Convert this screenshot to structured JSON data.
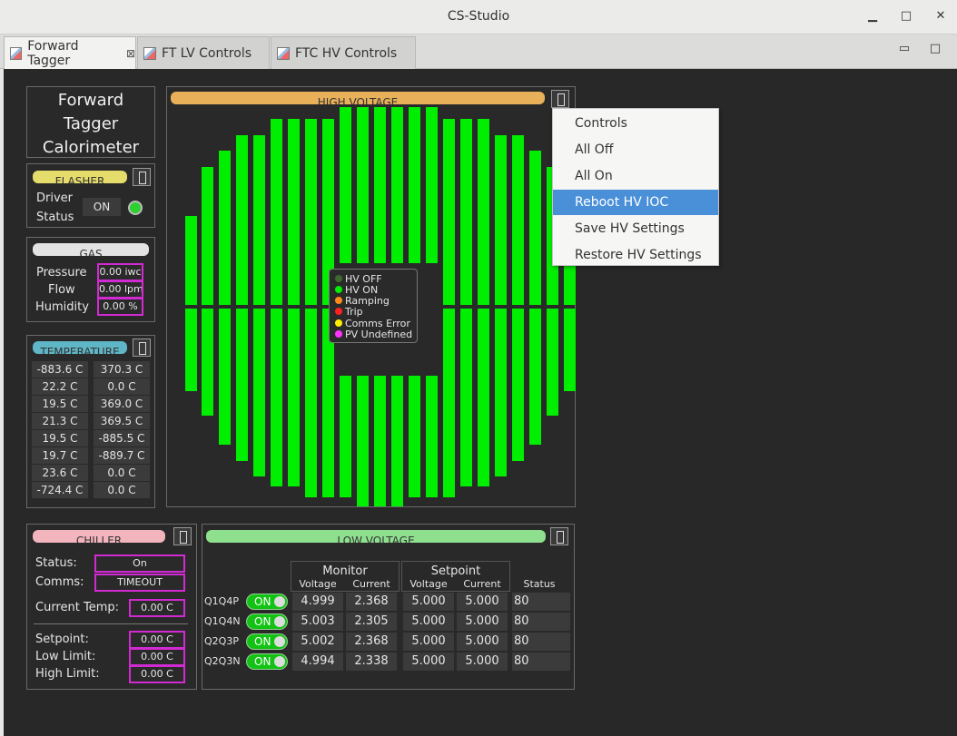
{
  "window": {
    "title": "CS-Studio"
  },
  "tabs": [
    {
      "label": "Forward Tagger"
    },
    {
      "label": "FT LV Controls"
    },
    {
      "label": "FTC HV Controls"
    }
  ],
  "title_box": {
    "line1": "Forward",
    "line2": "Tagger",
    "line3": "Calorimeter"
  },
  "flasher": {
    "header": "FLASHER",
    "driver_label": "Driver",
    "status_label": "Status",
    "button_label": "ON"
  },
  "gas": {
    "header": "GAS",
    "pressure_label": "Pressure",
    "pressure_value": "0.00 iwc",
    "flow_label": "Flow",
    "flow_value": "0.00 lpm",
    "humidity_label": "Humidity",
    "humidity_value": "0.00 %"
  },
  "temperature": {
    "header": "TEMPERATURE",
    "left": [
      "-883.6 C",
      "22.2 C",
      "19.5 C",
      "21.3 C",
      "19.5 C",
      "19.7 C",
      "23.6 C",
      "-724.4 C"
    ],
    "right": [
      "370.3 C",
      "0.0 C",
      "369.0 C",
      "369.5 C",
      "-885.5 C",
      "-889.7 C",
      "0.0 C",
      "0.0 C"
    ]
  },
  "high_voltage": {
    "header": "HIGH VOLTAGE",
    "legend": [
      {
        "label": "HV OFF",
        "color": "#3d6b2f"
      },
      {
        "label": "HV ON",
        "color": "#00ee00"
      },
      {
        "label": "Ramping",
        "color": "#ff8c1a"
      },
      {
        "label": "Trip",
        "color": "#ff2020"
      },
      {
        "label": "Comms Error",
        "color": "#ffee00"
      },
      {
        "label": "PV Undefined",
        "color": "#ff33ff"
      }
    ]
  },
  "chiller": {
    "header": "CHILLER",
    "status_label": "Status:",
    "status_value": "On",
    "comms_label": "Comms:",
    "comms_value": "TIMEOUT",
    "current_temp_label": "Current Temp:",
    "current_temp_value": "0.00 C",
    "setpoint_label": "Setpoint:",
    "setpoint_value": "0.00 C",
    "low_limit_label": "Low Limit:",
    "low_limit_value": "0.00 C",
    "high_limit_label": "High Limit:",
    "high_limit_value": "0.00 C"
  },
  "low_voltage": {
    "header": "LOW VOLTAGE",
    "monitor_label": "Monitor",
    "setpoint_label": "Setpoint",
    "voltage_label": "Voltage",
    "current_label": "Current",
    "status_label": "Status",
    "rows": [
      {
        "name": "Q1Q4P",
        "toggle": "ON",
        "mon_v": "4.999",
        "mon_i": "2.368",
        "set_v": "5.000",
        "set_i": "5.000",
        "status": "80"
      },
      {
        "name": "Q1Q4N",
        "toggle": "ON",
        "mon_v": "5.003",
        "mon_i": "2.305",
        "set_v": "5.000",
        "set_i": "5.000",
        "status": "80"
      },
      {
        "name": "Q2Q3P",
        "toggle": "ON",
        "mon_v": "5.002",
        "mon_i": "2.368",
        "set_v": "5.000",
        "set_i": "5.000",
        "status": "80"
      },
      {
        "name": "Q2Q3N",
        "toggle": "ON",
        "mon_v": "4.994",
        "mon_i": "2.338",
        "set_v": "5.000",
        "set_i": "5.000",
        "status": "80"
      }
    ]
  },
  "context_menu": {
    "items": [
      {
        "label": "Controls"
      },
      {
        "label": "All Off"
      },
      {
        "label": "All On"
      },
      {
        "label": "Reboot HV IOC",
        "selected": true
      },
      {
        "label": "Save HV Settings"
      },
      {
        "label": "Restore HV Settings"
      }
    ]
  },
  "colors": {
    "hv_on": "#00ee00",
    "background": "#282828",
    "alarm_border": "#d22ad2",
    "menu_highlight": "#4a90d9"
  }
}
